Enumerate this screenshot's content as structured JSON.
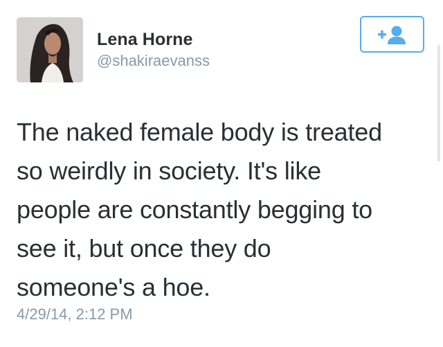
{
  "user": {
    "display_name": "Lena Horne",
    "handle": "@shakiraevanss",
    "avatar_icon": "profile-photo"
  },
  "follow_button": {
    "icon": "add-user-icon",
    "color": "#55acee"
  },
  "tweet": {
    "text": "The naked female body is treated\nso weirdly in society. It's like\npeople are constantly begging to\nsee it, but once they do\nsomeone's a hoe.",
    "timestamp": "4/29/14, 2:12 PM"
  },
  "colors": {
    "text": "#292f33",
    "muted": "#8899a6",
    "accent": "#55acee"
  }
}
